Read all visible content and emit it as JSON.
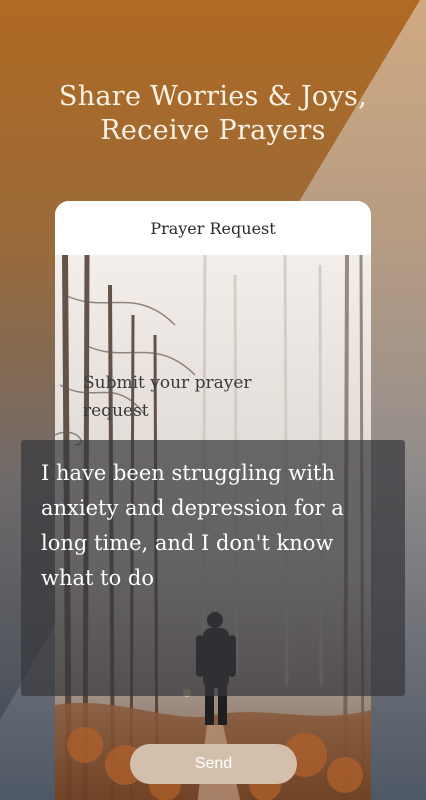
{
  "headline": {
    "line1": "Share Worries & Joys,",
    "line2": "Receive Prayers"
  },
  "phone": {
    "header_title": "Prayer Request",
    "prompt_placeholder": "Submit your prayer request",
    "request_text": "I have been struggling with anxiety and depression for a long time, and I don't know what to do",
    "send_label": "Send"
  },
  "colors": {
    "background_top": "#b06a22",
    "background_bottom": "#3d4856",
    "send_button": "#d3c0ac",
    "overlay": "#37373c"
  }
}
